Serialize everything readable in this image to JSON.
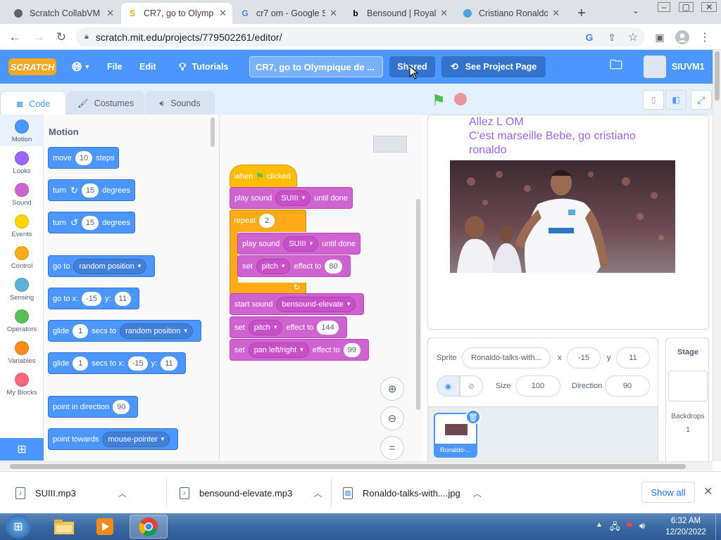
{
  "browser": {
    "tabs": [
      {
        "title": "Scratch CollabVM"
      },
      {
        "title": "CR7, go to Olymp"
      },
      {
        "title": "cr7 om - Google S"
      },
      {
        "title": "Bensound | Royalt"
      },
      {
        "title": "Cristiano Ronaldo"
      }
    ],
    "new_tab": "+",
    "url": "scratch.mit.edu/projects/779502261/editor/"
  },
  "menubar": {
    "logo": "SCRATCH",
    "file": "File",
    "edit": "Edit",
    "tutorials": "Tutorials",
    "project_title": "CR7, go to Olympique de ...",
    "shared": "Shared",
    "see_project_page": "See Project Page",
    "username": "SIUVM1"
  },
  "editor_tabs": {
    "code": "Code",
    "costumes": "Costumes",
    "sounds": "Sounds"
  },
  "categories": [
    {
      "label": "Motion",
      "color": "#4c97ff"
    },
    {
      "label": "Looks",
      "color": "#9966ff"
    },
    {
      "label": "Sound",
      "color": "#cf63cf"
    },
    {
      "label": "Events",
      "color": "#ffd500"
    },
    {
      "label": "Control",
      "color": "#ffab19"
    },
    {
      "label": "Sensing",
      "color": "#5cb1d6"
    },
    {
      "label": "Operators",
      "color": "#59c059"
    },
    {
      "label": "Variables",
      "color": "#ff8c1a"
    },
    {
      "label": "My Blocks",
      "color": "#ff6680"
    }
  ],
  "palette": {
    "heading": "Motion",
    "move": {
      "a": "move",
      "v": "10",
      "b": "steps"
    },
    "turn_right": {
      "a": "turn",
      "v": "15",
      "b": "degrees"
    },
    "turn_left": {
      "a": "turn",
      "v": "15",
      "b": "degrees"
    },
    "goto": {
      "a": "go to",
      "dd": "random position"
    },
    "goto_xy": {
      "a": "go to x:",
      "x": "-15",
      "b": "y:",
      "y": "11"
    },
    "glide_to": {
      "a": "glide",
      "v": "1",
      "b": "secs to",
      "dd": "random position"
    },
    "glide_xy": {
      "a": "glide",
      "v": "1",
      "b": "secs to x:",
      "x": "-15",
      "c": "y:",
      "y": "11"
    },
    "point_dir": {
      "a": "point in direction",
      "v": "90"
    },
    "point_towards": {
      "a": "point towards",
      "dd": "mouse-pointer"
    }
  },
  "script": {
    "when": "when",
    "clicked": "clicked",
    "play1": {
      "a": "play sound",
      "dd": "SUIII",
      "b": "until done"
    },
    "repeat": {
      "a": "repeat",
      "v": "2"
    },
    "play2": {
      "a": "play sound",
      "dd": "SUIII",
      "b": "until done"
    },
    "set1": {
      "a": "set",
      "dd": "pitch",
      "b": "effect to",
      "v": "80"
    },
    "start": {
      "a": "start sound",
      "dd": "bensound-elevate"
    },
    "set2": {
      "a": "set",
      "dd": "pitch",
      "b": "effect to",
      "v": "144"
    },
    "set3": {
      "a": "set",
      "dd": "pan left/right",
      "b": "effect to",
      "v": "99"
    }
  },
  "stage": {
    "text_line1": "Allez L OM",
    "text_line2": "C'est marseille Bebe, go cristiano",
    "text_line3": "ronaldo"
  },
  "sprite_info": {
    "sprite_label": "Sprite",
    "sprite_name": "Ronaldo-talks-with...",
    "x_label": "x",
    "x": "-15",
    "y_label": "y",
    "y": "11",
    "size_label": "Size",
    "size": "100",
    "direction_label": "Direction",
    "direction": "90",
    "thumb_label": "Ronaldo-..."
  },
  "stage_panel": {
    "title": "Stage",
    "backdrops_label": "Backdrops",
    "backdrops_count": "1"
  },
  "downloads": {
    "items": [
      {
        "name": "SUIII.mp3"
      },
      {
        "name": "bensound-elevate.mp3"
      },
      {
        "name": "Ronaldo-talks-with....jpg"
      }
    ],
    "show_all": "Show all"
  },
  "taskbar": {
    "time": "6:32 AM",
    "date": "12/20/2022"
  }
}
